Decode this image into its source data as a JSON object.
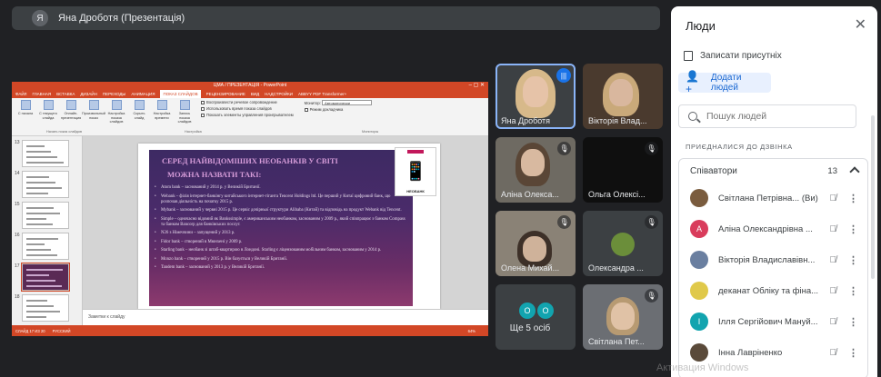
{
  "presenter": {
    "initial": "Я",
    "title": "Яна Дроботя (Презентація)"
  },
  "ppt": {
    "window_title": "ЦМА / ПРЕЗЕНТАЦІЯ - PowerPoint",
    "tabs": [
      "ФАЙЛ",
      "ГЛАВНАЯ",
      "ВСТАВКА",
      "ДИЗАЙН",
      "ПЕРЕХОДЫ",
      "АНИМАЦИЯ",
      "ПОКАЗ СЛАЙДОВ",
      "РЕЦЕНЗИРОВАНИЕ",
      "ВИД",
      "НАДСТРОЙКИ",
      "ABBYY PDF Transformer+"
    ],
    "active_tab": "ПОКАЗ СЛАЙДОВ",
    "ribbon_buttons": [
      "С начала",
      "С текущего слайда",
      "Онлайн-презентация",
      "Произвольный показ",
      "Настройка показа слайдов",
      "Скрыть слайд",
      "Настройка времени",
      "Запись показа слайдов"
    ],
    "ribbon_checks": [
      "Воспроизвести речевое сопровождение",
      "Использовать время показа слайдов",
      "Показать элементы управления проигрывателем"
    ],
    "monitor_label": "Монитор:",
    "monitor_value": "Автоматически",
    "presenter_view": "Режим докладчика",
    "group_labels": [
      "Начать показ слайдов",
      "Настройка",
      "Мониторы"
    ],
    "thumb_numbers": [
      "13",
      "14",
      "15",
      "16",
      "17",
      "18"
    ],
    "slide": {
      "title_line1": "СЕРЕД НАЙВІДОМІШИХ НЕОБАНКІВ У СВІТІ",
      "title_line2": "МОЖНА НАЗВАТИ ТАКІ:",
      "items": [
        "Atom bank – заснований у 2014 р. у Великій Британії.",
        "Webank – філія інтернет-банкінгу китайського інтернет-гіганта Tencent Holdings ltd. Це перший у Китаї цифровий банк, що розпочав діяльність на початку 2015 р.",
        "Mybank – заснований у червні 2015 р. Це сервіс дочірньої структури Alibaba (Китай) та відповідь на продукт Webank від Tencent.",
        "Simple – одночасно відомий як Bankssimple, є американським необанком, заснованим у 2009 р., який співпрацює з банком Compass та банком Bancorp для банківських послуг.",
        "N26 з Німеччини – запущений у 2013 р.",
        "Fidor bank – створений в Мюнхені у 2009 р.",
        "Starling bank – необанк зі штаб-квартирою в Лондоні. Starling є ліцензованим мобільним банком, заснованим у 2014 р.",
        "Monzo bank – створений у 2015 р. Він базується у Великій Британії.",
        "Tandem bank – заснований у 2013 р. у Великій Британії."
      ],
      "logo_caption": "НЕОБАНК"
    },
    "notes_placeholder": "Заметки к слайду",
    "status_slide": "СЛАЙД 17 ИЗ 20",
    "status_lang": "РУССКИЙ",
    "status_zoom": "64%"
  },
  "tiles": [
    {
      "name": "Яна Дроботя",
      "state": "speaking"
    },
    {
      "name": "Вікторія Влад...",
      "state": "video"
    },
    {
      "name": "Аліна Олекса...",
      "state": "muted"
    },
    {
      "name": "Ольга Олексі...",
      "state": "muted"
    },
    {
      "name": "Олена Михай...",
      "state": "muted"
    },
    {
      "name": "Олександра ...",
      "state": "muted"
    },
    {
      "name": "Ще 5 осіб",
      "state": "others"
    },
    {
      "name": "Світлана Пет...",
      "state": "muted"
    }
  ],
  "others_initials": [
    "О",
    "О"
  ],
  "panel": {
    "title": "Люди",
    "record_attendance": "Записати присутніх",
    "add_people": "Додати людей",
    "search_placeholder": "Пошук людей",
    "section": "ПРИЄДНАЛИСЯ ДО ДЗВІНКА",
    "group_name": "Співавтори",
    "group_count": "13",
    "people": [
      {
        "name": "Світлана Петрівна... (Ви)",
        "initial": "",
        "color": "#7a5c3e"
      },
      {
        "name": "Аліна Олександрівна ...",
        "initial": "A",
        "color": "#d93c5c"
      },
      {
        "name": "Вікторія Владиславівн...",
        "initial": "",
        "color": "#6a7fa0"
      },
      {
        "name": "деканат Обліку та фіна...",
        "initial": "",
        "color": "#e0c94a"
      },
      {
        "name": "Ілля Сергійович Мануй...",
        "initial": "I",
        "color": "#12a4af"
      },
      {
        "name": "Інна Лавріненко",
        "initial": "",
        "color": "#5a4a3a"
      }
    ]
  },
  "watermark": "Активация Windows"
}
